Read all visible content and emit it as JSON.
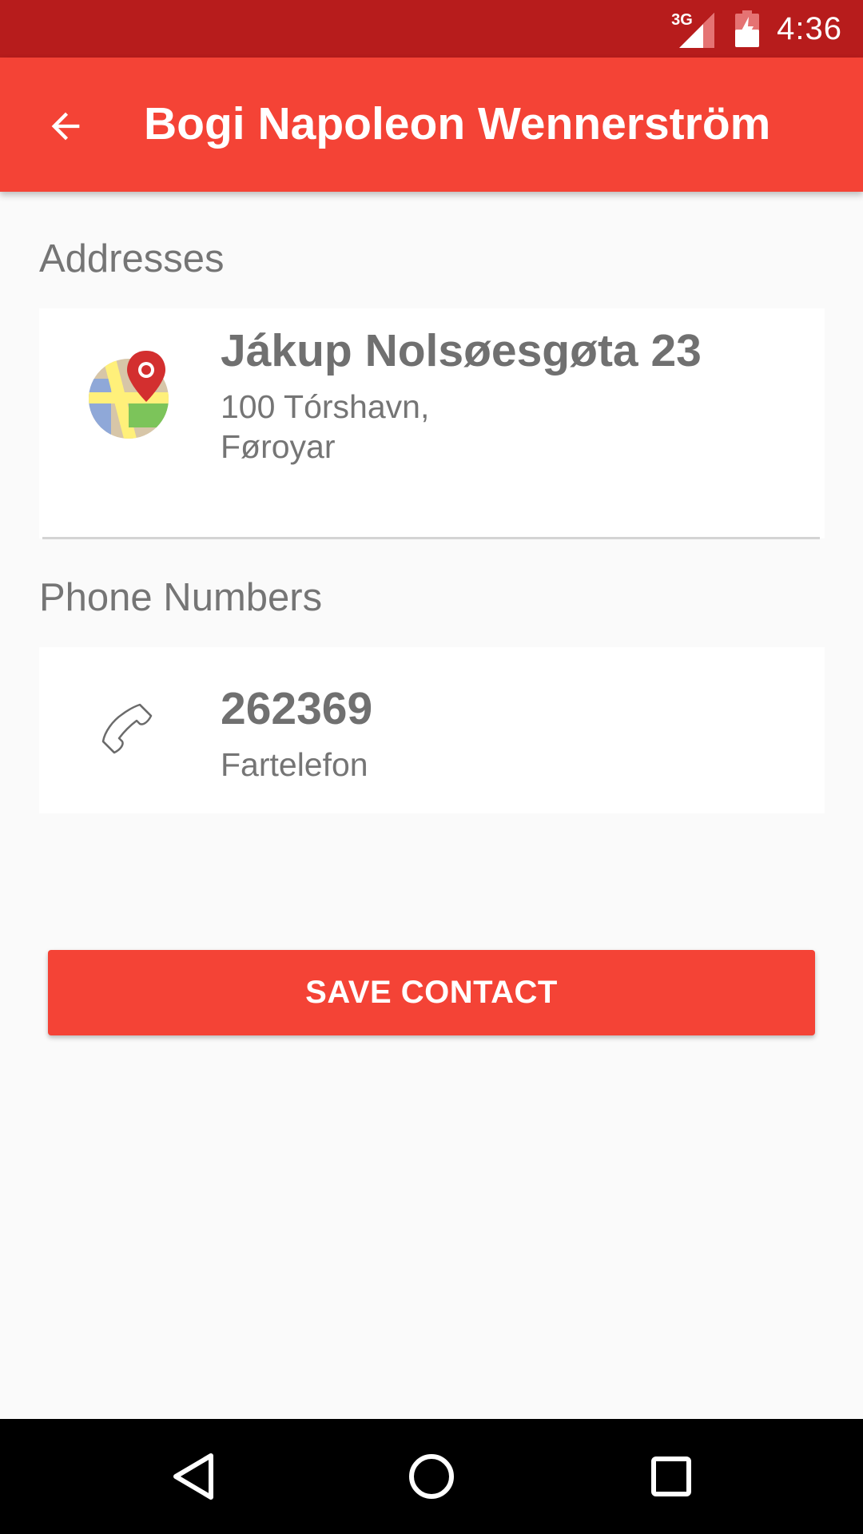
{
  "status_bar": {
    "network": "3G",
    "time": "4:36",
    "icons": [
      "signal-icon",
      "battery-charging-icon"
    ]
  },
  "app_bar": {
    "title": "Bogi Napoleon Wennerström",
    "back_icon": "arrow-back-icon"
  },
  "addresses": {
    "section_label": "Addresses",
    "items": [
      {
        "street": "Jákup Nolsøesgøta 23",
        "city_line": "100 Tórshavn,",
        "country": "Føroyar",
        "icon": "map-pin-icon"
      }
    ]
  },
  "phones": {
    "section_label": "Phone Numbers",
    "items": [
      {
        "number": "262369",
        "type": "Fartelefon",
        "icon": "phone-icon"
      }
    ]
  },
  "actions": {
    "save_label": "SAVE CONTACT"
  },
  "nav_bar": {
    "icons": [
      "nav-back-icon",
      "nav-home-icon",
      "nav-recents-icon"
    ]
  },
  "colors": {
    "status_bar": "#b71c1c",
    "primary": "#f44336",
    "background": "#fafafa",
    "text_secondary": "#757575"
  }
}
